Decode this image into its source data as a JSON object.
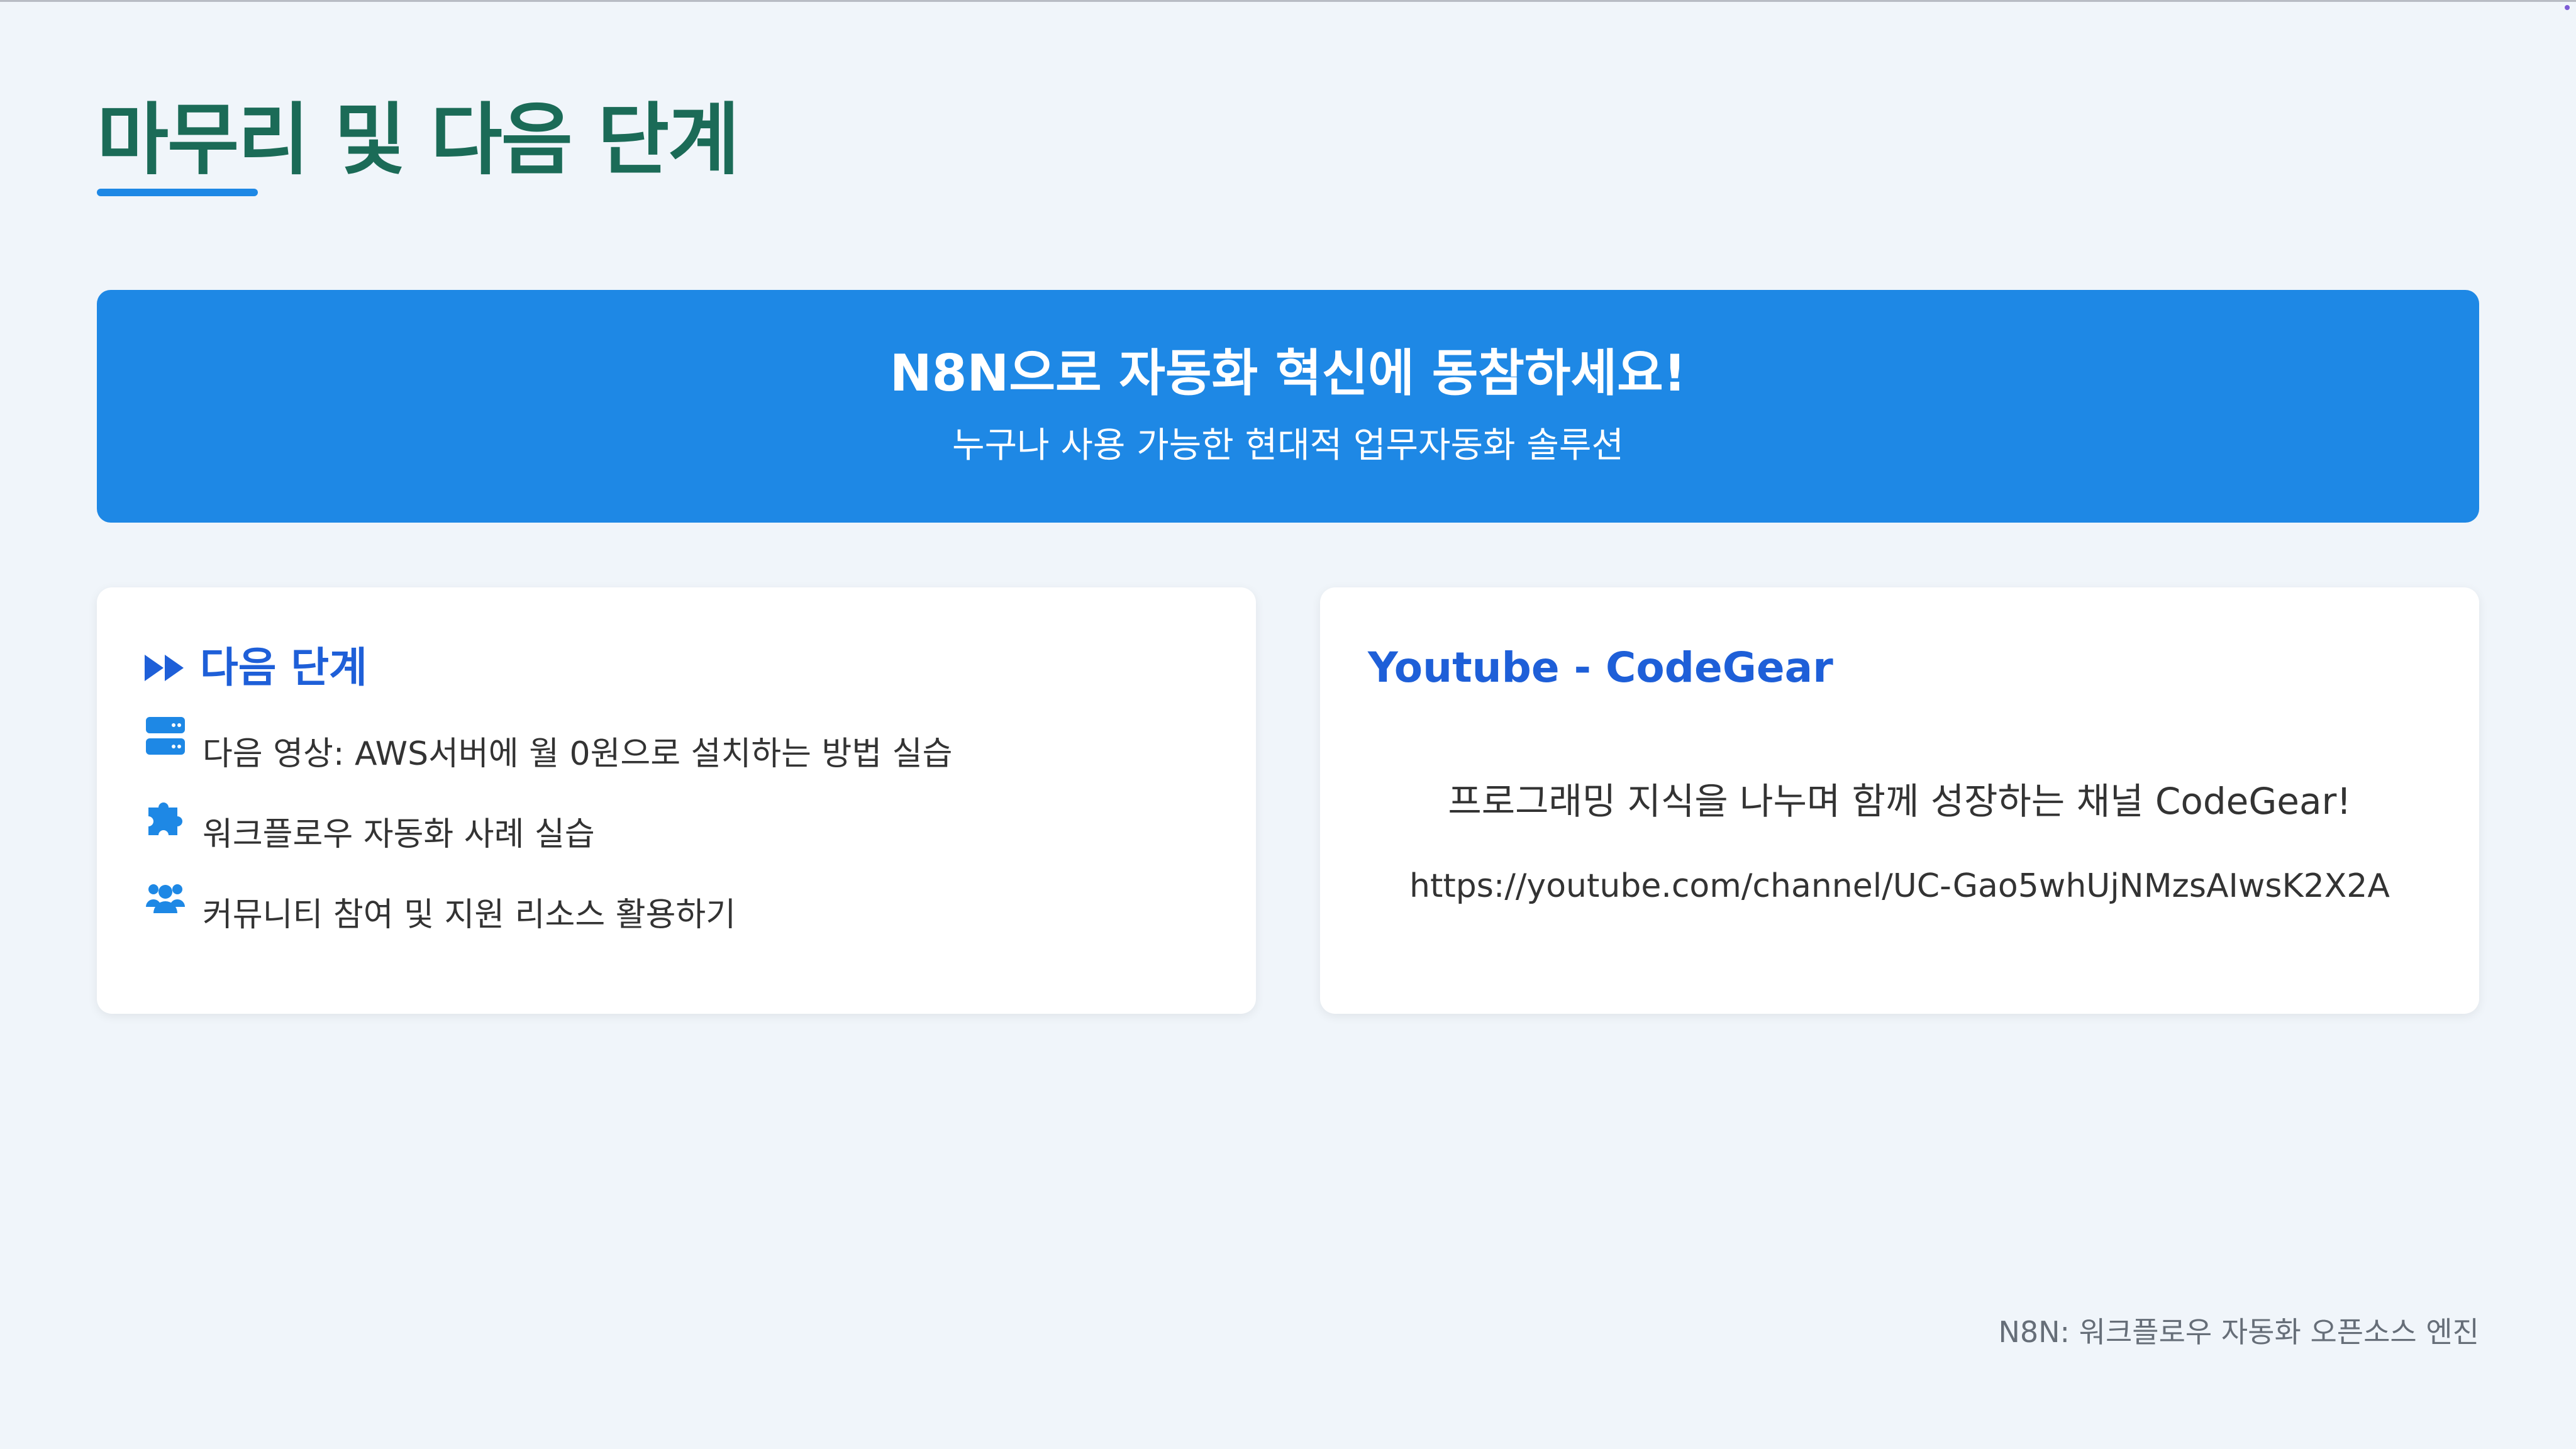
{
  "header": {
    "title": "마무리 및 다음 단계"
  },
  "banner": {
    "title": "N8N으로 자동화 혁신에 동참하세요!",
    "subtitle": "누구나 사용 가능한 현대적 업무자동화 솔루션"
  },
  "next_steps": {
    "heading": "다음 단계",
    "heading_icon": "forward-icon",
    "items": [
      {
        "icon": "server-icon",
        "label": "다음 영상: AWS서버에 월 0원으로 설치하는 방법 실습"
      },
      {
        "icon": "puzzle-piece-icon",
        "label": "워크플로우 자동화 사례 실습"
      },
      {
        "icon": "users-icon",
        "label": "커뮤니티 참여 및 지원 리소스 활용하기"
      }
    ]
  },
  "youtube": {
    "heading": "Youtube - CodeGear",
    "description": "프로그래밍 지식을 나누며 함께 성장하는 채널 CodeGear!",
    "url": "https://youtube.com/channel/UC-Gao5whUjNMzsAIwsK2X2A"
  },
  "footer": {
    "text": "N8N: 워크플로우 자동화 오픈소스 엔진"
  },
  "colors": {
    "background": "#f0f5fa",
    "title": "#1b6b57",
    "accent": "#1e88e5",
    "heading_blue": "#1e5fd8",
    "card": "#ffffff",
    "footer_text": "#666e78"
  }
}
